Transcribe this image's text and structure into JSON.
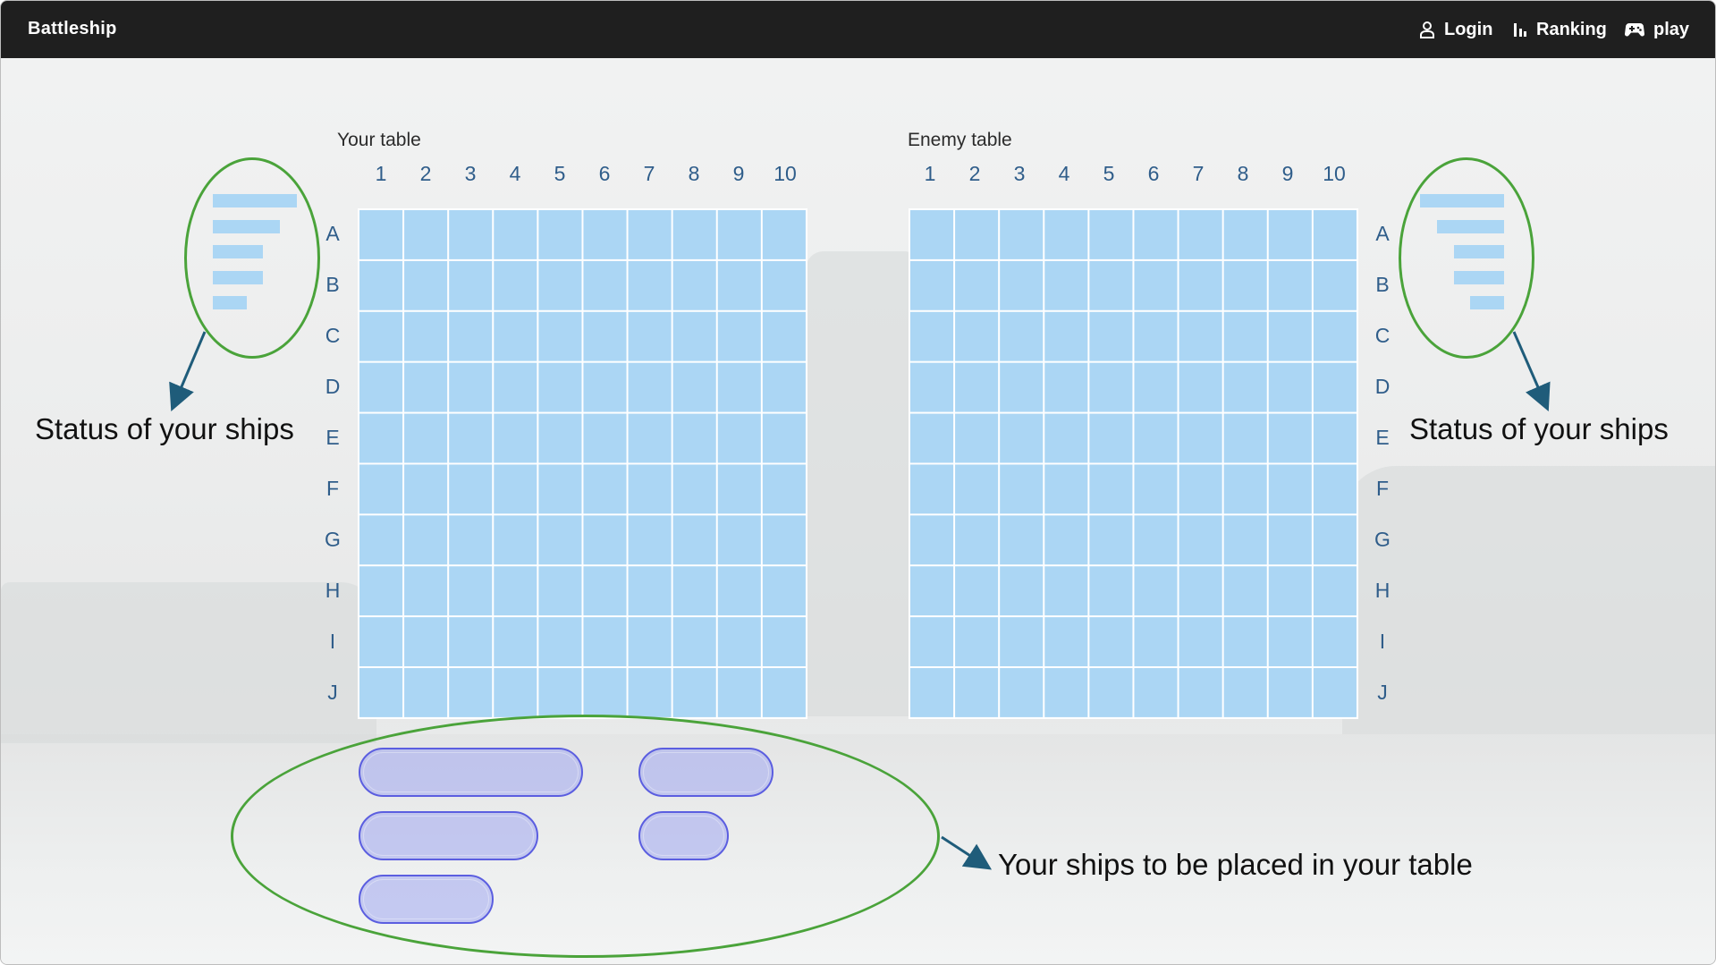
{
  "navbar": {
    "brand": "Battleship",
    "items": [
      {
        "label": "Login",
        "icon": "user-icon"
      },
      {
        "label": "Ranking",
        "icon": "bar-chart-icon"
      },
      {
        "label": "play",
        "icon": "gamepad-icon"
      }
    ]
  },
  "your_table": {
    "title": "Your table",
    "columns": [
      "1",
      "2",
      "3",
      "4",
      "5",
      "6",
      "7",
      "8",
      "9",
      "10"
    ],
    "rows": [
      "A",
      "B",
      "C",
      "D",
      "E",
      "F",
      "G",
      "H",
      "I",
      "J"
    ]
  },
  "enemy_table": {
    "title": "Enemy table",
    "columns": [
      "1",
      "2",
      "3",
      "4",
      "5",
      "6",
      "7",
      "8",
      "9",
      "10"
    ],
    "rows": [
      "A",
      "B",
      "C",
      "D",
      "E",
      "F",
      "G",
      "H",
      "I",
      "J"
    ]
  },
  "annotations": {
    "status_left": "Status of your ships",
    "status_right": "Status of your ships",
    "ships_to_place": "Your ships to be placed in your table"
  },
  "ships": [
    {
      "name": "ship-5",
      "length": 5
    },
    {
      "name": "ship-4",
      "length": 4
    },
    {
      "name": "ship-3a",
      "length": 3
    },
    {
      "name": "ship-3b",
      "length": 3
    },
    {
      "name": "ship-2",
      "length": 2
    }
  ],
  "colors": {
    "navbar": "#1f1f1f",
    "grid_cell": "#abd6f4",
    "grid_line": "#ffffff",
    "label_blue": "#2f5d8a",
    "annotation_green": "#4aa33a",
    "annotation_arrow": "#1f5c7a",
    "ship_fill": "#a0a8f0",
    "ship_border": "#5b5ee0"
  }
}
